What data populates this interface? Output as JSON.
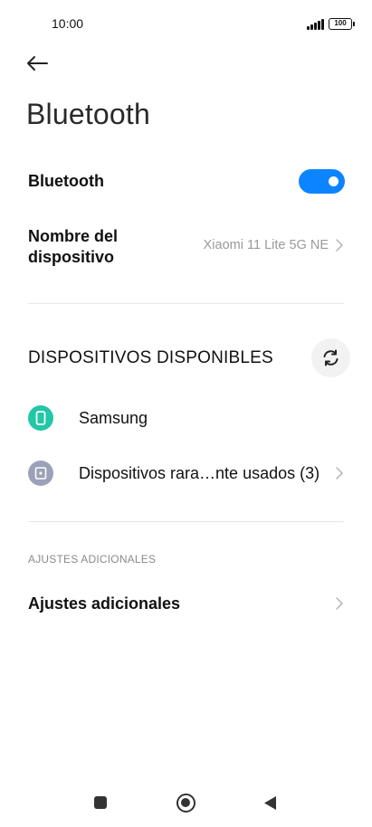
{
  "status_bar": {
    "time": "10:00",
    "battery": "100",
    "icons": [
      "signal-icon",
      "battery-icon"
    ]
  },
  "header": {
    "back_icon": "arrow-left-icon",
    "title": "Bluetooth"
  },
  "bluetooth_row": {
    "label": "Bluetooth",
    "enabled": true,
    "accent_color": "#0d84ff"
  },
  "device_name_row": {
    "label_line1": "Nombre del",
    "label_line2": "dispositivo",
    "value": "Xiaomi 11 Lite 5G NE"
  },
  "available_devices": {
    "title": "DISPOSITIVOS DISPONIBLES",
    "refresh_icon": "refresh-icon",
    "items": [
      {
        "label": "Samsung",
        "icon": "phone-icon",
        "icon_color": "#21c7a7"
      },
      {
        "label": "Dispositivos rara…nte usados (3)",
        "icon": "device-icon",
        "icon_color": "#9aa1b8"
      }
    ]
  },
  "additional": {
    "section_label": "AJUSTES ADICIONALES",
    "item_label": "Ajustes adicionales"
  },
  "nav_bar": {
    "icons": [
      "recents-icon",
      "home-icon",
      "back-icon"
    ]
  }
}
